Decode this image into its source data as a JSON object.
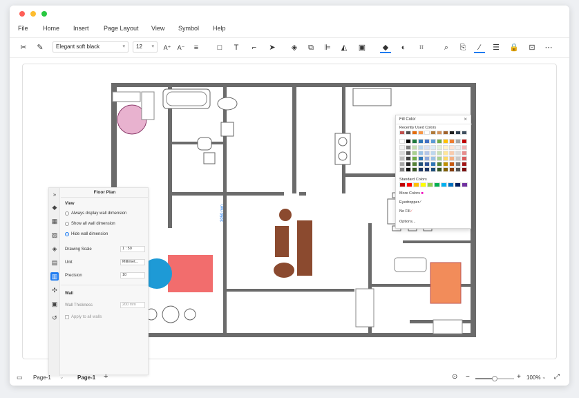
{
  "window": {
    "dots": [
      "#fe5f57",
      "#febc2e",
      "#28c840"
    ]
  },
  "menu": [
    "File",
    "Home",
    "Insert",
    "Page Layout",
    "View",
    "Symbol",
    "Help"
  ],
  "toolbar": {
    "font": "Elegant soft black",
    "size": "12"
  },
  "plan": {
    "wall_color": "#6b6b6b",
    "dimension_label": "3050 mm",
    "bed_color": "#f26d6d",
    "rug_color": "#e8b2cf",
    "sofa_color": "#8b4a2f",
    "bed2_color": "#f28c5a",
    "round_chair_color": "#1e9ad6"
  },
  "floor_plan_panel": {
    "title": "Floor Plan",
    "view_heading": "View",
    "opt1": "Always display wall dimension",
    "opt2": "Show all wall dimension",
    "opt3": "Hide wall dimension",
    "scale_label": "Drawing Scale",
    "scale_value": "1 : 50",
    "unit_label": "Unit",
    "unit_value": "Millimet...",
    "precision_label": "Precision",
    "precision_value": "10",
    "wall_heading": "Wall",
    "thickness_label": "Wall Thickness",
    "thickness_value": "200 mm",
    "apply_label": "Apply to all walls",
    "side_icons": [
      "fill-icon",
      "grid-icon",
      "image-icon",
      "layers-icon",
      "page-icon",
      "floorplan-icon",
      "fit-icon",
      "present-icon",
      "history-icon"
    ]
  },
  "fill_color": {
    "title": "Fill Color",
    "recent_label": "Recently Used Colors",
    "recent_colors": [
      "#c0504d",
      "#4f4f4f",
      "#e46c0a",
      "#f79646",
      "#ffffff",
      "#b07a3a",
      "#d4925a",
      "#a0622b",
      "#1f1f1f",
      "#2f3f4f",
      "#3f4f5f"
    ],
    "theme_top": [
      "#ffffff",
      "#000000",
      "#1f7a3e",
      "#2e75b6",
      "#4472c4",
      "#5b9bd5",
      "#70ad47",
      "#ffc000",
      "#ed7d31",
      "#a5a5a5",
      "#c00000"
    ],
    "theme_tints": [
      [
        "#f2f2f2",
        "#7f7f7f",
        "#c6e0b4",
        "#bdd7ee",
        "#d9e1f2",
        "#ddebf7",
        "#e2efda",
        "#fff2cc",
        "#fce4d6",
        "#ededed",
        "#f4b6b6"
      ],
      [
        "#d9d9d9",
        "#595959",
        "#a9d08e",
        "#9bc2e6",
        "#b4c6e7",
        "#bdd7ee",
        "#c6e0b4",
        "#ffe699",
        "#f8cbad",
        "#dbdbdb",
        "#e88d8d"
      ],
      [
        "#bfbfbf",
        "#404040",
        "#70ad47",
        "#2f75b5",
        "#8ea9db",
        "#9bc2e6",
        "#a9d08e",
        "#ffd966",
        "#f4b084",
        "#c9c9c9",
        "#d95f5f"
      ],
      [
        "#a6a6a6",
        "#262626",
        "#548235",
        "#1f4e79",
        "#305496",
        "#2f75b5",
        "#548235",
        "#bf8f00",
        "#c65911",
        "#7b7b7b",
        "#a31515"
      ],
      [
        "#808080",
        "#0d0d0d",
        "#375623",
        "#1f3864",
        "#203764",
        "#1f4e79",
        "#375623",
        "#806000",
        "#843c0c",
        "#525252",
        "#7a0f0f"
      ]
    ],
    "standard_label": "Standard Colors",
    "standard_colors": [
      "#c00000",
      "#ff0000",
      "#ffc000",
      "#ffff00",
      "#92d050",
      "#00b050",
      "#00b0f0",
      "#0070c0",
      "#002060",
      "#7030a0"
    ],
    "more": "More Colors",
    "eyedropper": "Eyedropper",
    "nofill": "No Fill",
    "options": "Options..."
  },
  "status": {
    "page_dropdown": "Page-1",
    "page_tab": "Page-1",
    "zoom": "100%"
  }
}
